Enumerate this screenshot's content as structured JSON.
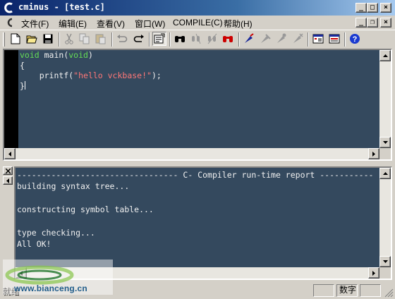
{
  "window": {
    "title": "cminus - [test.c]",
    "buttons": [
      "_",
      "□",
      "×"
    ],
    "inner_buttons": [
      "_",
      "❐",
      "×"
    ]
  },
  "menu": {
    "items": [
      "文件(F)",
      "编辑(E)",
      "查看(V)",
      "窗口(W)",
      "COMPILE(C)",
      "帮助(H)"
    ]
  },
  "toolbar": {
    "icons": [
      "new-file-icon",
      "open-folder-icon",
      "save-icon",
      "cut-icon",
      "copy-icon",
      "paste-icon",
      "undo-icon",
      "redo-icon",
      "properties-icon",
      "find-icon",
      "find-next-icon",
      "replace-icon",
      "compile-icon",
      "build-icon",
      "run-icon",
      "debug-icon",
      "bookmark-icon",
      "tools-icon",
      "help-icon"
    ]
  },
  "editor": {
    "lines": [
      {
        "kw": "void",
        "rest": " main(",
        "kw2": "void",
        "end": ")"
      },
      {
        "text": "{"
      },
      {
        "indent": "    ",
        "call": "printf(",
        "str": "\"hello vckbase!\"",
        "end": ");"
      },
      {
        "text": "}"
      }
    ]
  },
  "output": {
    "lines": [
      "--------------------------------- C- Compiler run-time report -----------",
      "building syntax tree...",
      "",
      "constructing symbol table...",
      "",
      "type checking...",
      "All OK!"
    ]
  },
  "status": {
    "text": "就绪",
    "num": "数字"
  },
  "watermark": {
    "text": "www.bianceng.cn"
  }
}
